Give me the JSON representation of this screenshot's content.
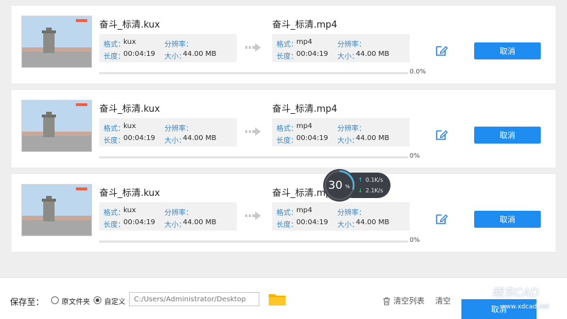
{
  "tasks": [
    {
      "source": {
        "filename": "奋斗_标清.kux",
        "format_label": "格式：",
        "format": "kux",
        "resolution_label": "分辨率：",
        "duration_label": "长度：",
        "duration": "00:04:19",
        "size_label": "大小：",
        "size": "44.00 MB"
      },
      "target": {
        "filename": "奋斗_标清.mp4",
        "format_label": "格式：",
        "format": "mp4",
        "resolution_label": "分辨率：",
        "duration_label": "长度：",
        "duration": "00:04:19",
        "size_label": "大小：",
        "size": "44.00 MB"
      },
      "progress_text": "0.0%",
      "progress": 0,
      "cancel_label": "取消"
    },
    {
      "source": {
        "filename": "奋斗_标清.kux",
        "format_label": "格式：",
        "format": "kux",
        "resolution_label": "分辨率：",
        "duration_label": "长度：",
        "duration": "00:04:19",
        "size_label": "大小：",
        "size": "44.00 MB"
      },
      "target": {
        "filename": "奋斗_标清.mp4",
        "format_label": "格式：",
        "format": "mp4",
        "resolution_label": "分辨率：",
        "duration_label": "长度：",
        "duration": "00:04:19",
        "size_label": "大小：",
        "size": "44.00 MB"
      },
      "progress_text": "0%",
      "progress": 0,
      "cancel_label": "取消"
    },
    {
      "source": {
        "filename": "奋斗_标清.kux",
        "format_label": "格式：",
        "format": "kux",
        "resolution_label": "分辨率：",
        "duration_label": "长度：",
        "duration": "00:04:19",
        "size_label": "大小：",
        "size": "44.00 MB"
      },
      "target": {
        "filename": "奋斗_标清.mp4",
        "format_label": "格式：",
        "format": "mp4",
        "resolution_label": "分辨率：",
        "duration_label": "长度：",
        "duration": "00:04:19",
        "size_label": "大小：",
        "size": "44.00 MB"
      },
      "progress_text": "0%",
      "progress": 0,
      "cancel_label": "取消"
    }
  ],
  "speed_widget": {
    "percent": "30",
    "percent_symbol": "%",
    "percent_value": 30,
    "upload": "0.1K/s",
    "download": "2.1K/s",
    "ring_color": "#49b8e8"
  },
  "footer": {
    "save_to_label": "保存至：",
    "option_original": "原文件夹",
    "option_custom": "自定义",
    "selected_option": "custom",
    "path": "C:/Users/Administrator/Desktop",
    "clear_list_label": "清空列表",
    "clear_label": "清空",
    "cancel_label": "取消"
  },
  "watermark": {
    "name": "晓东CAD",
    "url": "www.xdcad.net"
  },
  "colors": {
    "accent": "#1e8cf0",
    "label_blue": "#3a86c8",
    "folder": "#f5b400"
  },
  "icons": {
    "edit": "edit-icon",
    "arrows": "arrows-icon",
    "folder": "folder-icon",
    "trash": "trash-icon"
  }
}
